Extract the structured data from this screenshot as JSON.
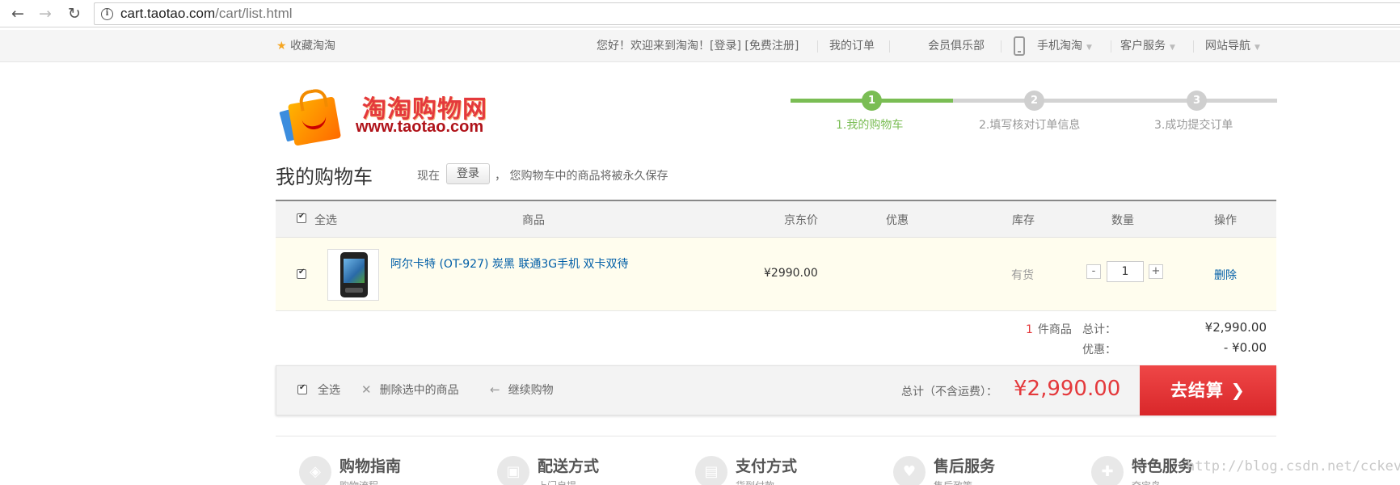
{
  "browser": {
    "url_host": "cart.taotao.com",
    "url_path": "/cart/list.html",
    "back_icon": "←",
    "forward_icon": "→",
    "reload_icon": "↻",
    "info_icon": "i"
  },
  "topbar": {
    "favorite": "收藏淘淘",
    "welcome": "您好！欢迎来到淘淘！[登录] [免费注册]",
    "orders": "我的订单",
    "club": "会员俱乐部",
    "mobile": "手机淘淘",
    "service": "客户服务",
    "sitenav": "网站导航"
  },
  "logo": {
    "name": "淘淘购物网",
    "url": "www.taotao.com"
  },
  "steps": [
    {
      "num": "1",
      "label": "1.我的购物车"
    },
    {
      "num": "2",
      "label": "2.填写核对订单信息"
    },
    {
      "num": "3",
      "label": "3.成功提交订单"
    }
  ],
  "cart": {
    "title": "我的购物车",
    "hint_prefix": "现在",
    "login_label": "登录",
    "hint_suffix": "，  您购物车中的商品将被永久保存"
  },
  "table": {
    "headers": {
      "select_all": "全选",
      "product": "商品",
      "price": "京东价",
      "discount": "优惠",
      "stock": "库存",
      "quantity": "数量",
      "action": "操作"
    },
    "items": [
      {
        "name": "阿尔卡特 (OT-927) 炭黑 联通3G手机 双卡双待",
        "price": "¥2990.00",
        "stock": "有货",
        "quantity": "1",
        "delete": "删除"
      }
    ]
  },
  "summary": {
    "count": "1",
    "count_label": "件商品",
    "total_label": "总计：",
    "total_value": "¥2,990.00",
    "discount_label": "优惠：",
    "discount_value": "- ¥0.00"
  },
  "toolbar": {
    "select_all": "全选",
    "delete_selected": "删除选中的商品",
    "continue": "继续购物",
    "total_label": "总计（不含运费）：",
    "total_value": "¥2,990.00",
    "checkout": "去结算",
    "checkout_arrow": "❯"
  },
  "services": [
    {
      "title": "购物指南",
      "sub": "购物流程"
    },
    {
      "title": "配送方式",
      "sub": "上门自提"
    },
    {
      "title": "支付方式",
      "sub": "货到付款"
    },
    {
      "title": "售后服务",
      "sub": "售后政策"
    },
    {
      "title": "特色服务",
      "sub": "夺宝岛"
    }
  ],
  "watermark": "http://blog.csdn.net/cckevincyh",
  "colors": {
    "accent_red": "#e4393c",
    "step_green": "#7abd54",
    "link_blue": "#005ea7"
  }
}
